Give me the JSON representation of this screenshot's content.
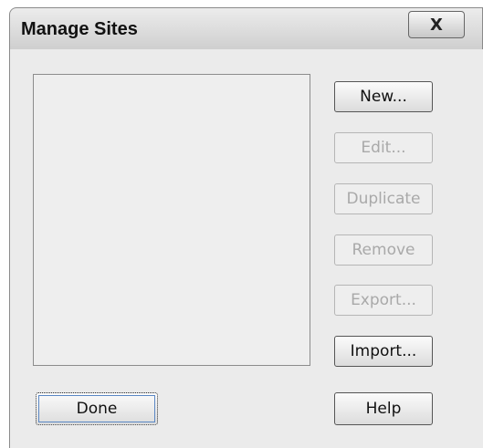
{
  "dialog": {
    "title": "Manage Sites",
    "close_label": "X"
  },
  "buttons": {
    "new": "New...",
    "edit": "Edit...",
    "duplicate": "Duplicate",
    "remove": "Remove",
    "export": "Export...",
    "import": "Import...",
    "done": "Done",
    "help": "Help"
  },
  "state": {
    "disabled": [
      "edit",
      "duplicate",
      "remove",
      "export"
    ]
  }
}
